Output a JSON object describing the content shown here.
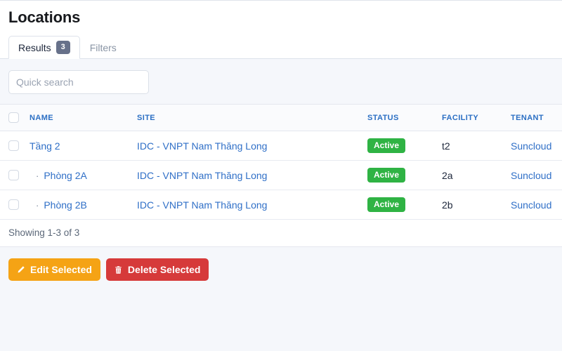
{
  "page": {
    "title": "Locations"
  },
  "tabs": [
    {
      "label": "Results",
      "badge": "3",
      "active": true,
      "name": "tab-results"
    },
    {
      "label": "Filters",
      "badge": "",
      "active": false,
      "name": "tab-filters"
    }
  ],
  "search": {
    "placeholder": "Quick search",
    "value": ""
  },
  "table": {
    "columns": [
      "NAME",
      "SITE",
      "STATUS",
      "FACILITY",
      "TENANT"
    ],
    "rows": [
      {
        "name": "Tầng 2",
        "indent": false,
        "site": "IDC - VNPT Nam Thăng Long",
        "status": "Active",
        "facility": "t2",
        "tenant": "Suncloud"
      },
      {
        "name": "Phòng 2A",
        "indent": true,
        "site": "IDC - VNPT Nam Thăng Long",
        "status": "Active",
        "facility": "2a",
        "tenant": "Suncloud"
      },
      {
        "name": "Phòng 2B",
        "indent": true,
        "site": "IDC - VNPT Nam Thăng Long",
        "status": "Active",
        "facility": "2b",
        "tenant": "Suncloud"
      }
    ],
    "footer": "Showing 1-3 of 3"
  },
  "actions": {
    "edit_label": "Edit Selected",
    "edit_icon": "pencil-icon",
    "delete_label": "Delete Selected",
    "delete_icon": "trash-icon"
  },
  "colors": {
    "status_active": "#2fb344",
    "edit_button": "#f5a315",
    "delete_button": "#d63a3a",
    "link": "#2f6fc7",
    "badge": "#67718a",
    "page_background": "#f5f7fb"
  }
}
